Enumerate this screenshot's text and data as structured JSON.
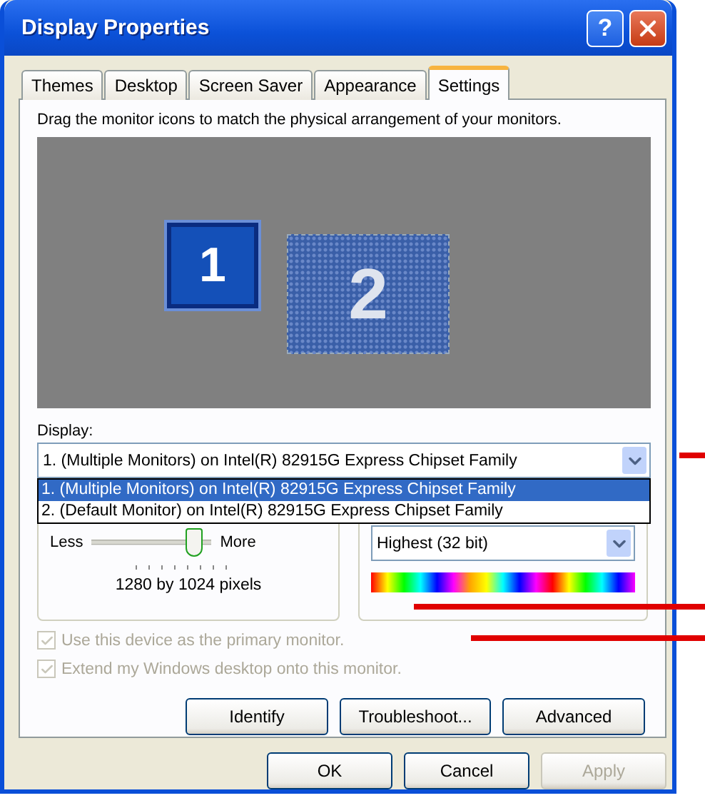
{
  "window": {
    "title": "Display Properties",
    "help": "?"
  },
  "tabs": [
    {
      "label": "Themes",
      "selected": false
    },
    {
      "label": "Desktop",
      "selected": false
    },
    {
      "label": "Screen Saver",
      "selected": false
    },
    {
      "label": "Appearance",
      "selected": false
    },
    {
      "label": "Settings",
      "selected": true
    }
  ],
  "instruction": "Drag the monitor icons to match the physical arrangement of your monitors.",
  "monitors": [
    {
      "label": "1",
      "selected": true
    },
    {
      "label": "2",
      "selected": false
    }
  ],
  "display": {
    "label": "Display:",
    "value": "1. (Multiple Monitors) on Intel(R) 82915G Express Chipset Family",
    "options": [
      {
        "text": "1. (Multiple Monitors) on Intel(R) 82915G Express Chipset Family",
        "selected": true
      },
      {
        "text": "2. (Default Monitor) on Intel(R) 82915G Express Chipset Family",
        "selected": false
      }
    ]
  },
  "resolution": {
    "min_label": "Less",
    "max_label": "More",
    "level": 0.86,
    "reading": "1280 by 1024 pixels"
  },
  "color_quality": {
    "value": "Highest (32 bit)"
  },
  "checkboxes": [
    {
      "label": "Use this device as the primary monitor.",
      "checked": true,
      "disabled": true
    },
    {
      "label": "Extend my Windows desktop onto this monitor.",
      "checked": true,
      "disabled": true
    }
  ],
  "panel_buttons": [
    "Identify",
    "Troubleshoot...",
    "Advanced"
  ],
  "dialog_buttons": [
    {
      "label": "OK",
      "disabled": false
    },
    {
      "label": "Cancel",
      "disabled": false
    },
    {
      "label": "Apply",
      "disabled": true
    }
  ]
}
